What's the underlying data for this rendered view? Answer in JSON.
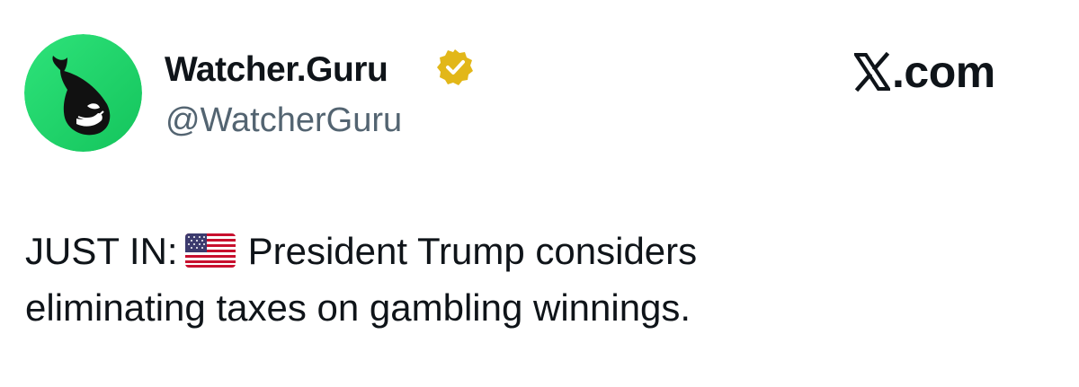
{
  "post": {
    "author": {
      "display_name": "Watcher.Guru",
      "handle": "@WatcherGuru",
      "verified": true,
      "avatar_icon": "whale-logo-icon",
      "avatar_color": "#22d66b"
    },
    "source": {
      "logo_icon": "x-logo-icon",
      "text": ".com"
    },
    "text": {
      "prefix": "JUST IN:",
      "flag_icon": "us-flag-icon",
      "line1_rest": "President Trump considers",
      "line2": "eliminating taxes on gambling winnings."
    }
  },
  "colors": {
    "text_primary": "#0f1419",
    "text_secondary": "#536471",
    "verified_badge": "#e2b719"
  }
}
